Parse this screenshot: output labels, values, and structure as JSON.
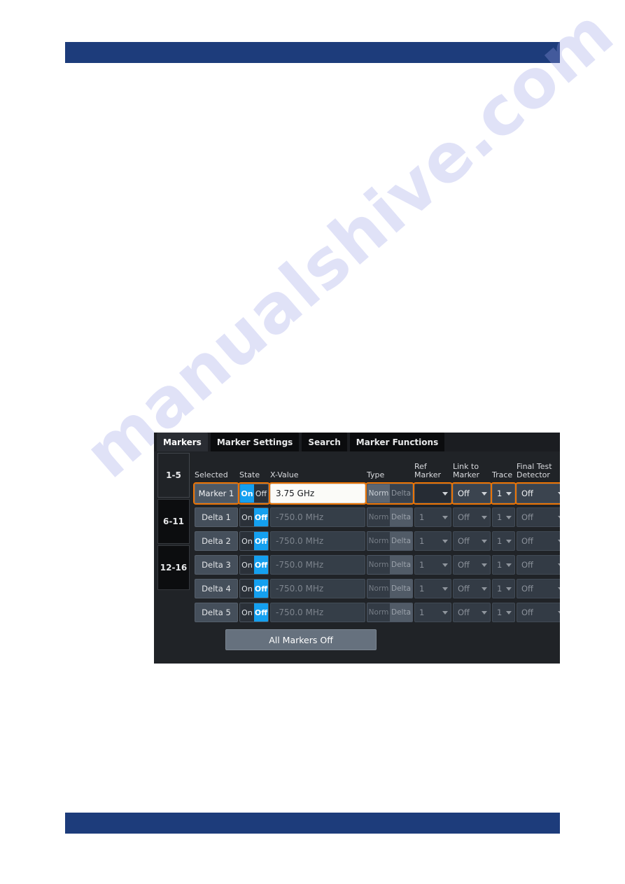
{
  "watermark": {
    "text": "manualshive.com"
  },
  "dialog": {
    "tabs": [
      {
        "label": "Markers",
        "active": true
      },
      {
        "label": "Marker Settings",
        "active": false
      },
      {
        "label": "Search",
        "active": false
      },
      {
        "label": "Marker Functions",
        "active": false
      }
    ],
    "range_buttons": [
      {
        "label": "1-5",
        "active": true
      },
      {
        "label": "6-11",
        "active": false
      },
      {
        "label": "12-16",
        "active": false
      }
    ],
    "columns": {
      "selected": "Selected",
      "state": "State",
      "xvalue": "X-Value",
      "type": "Type",
      "ref_marker_l1": "Ref",
      "ref_marker_l2": "Marker",
      "link_l1": "Link to",
      "link_l2": "Marker",
      "trace": "Trace",
      "detector_l1": "Final Test",
      "detector_l2": "Detector"
    },
    "type_options": {
      "norm": "Norm",
      "delta": "Delta"
    },
    "state_options": {
      "on": "On",
      "off": "Off"
    },
    "rows": [
      {
        "selected": "Marker 1",
        "state": "On",
        "xvalue": "3.75 GHz",
        "type": "Norm",
        "ref_marker": "",
        "link_to_marker": "Off",
        "trace": "1",
        "final_test_detector": "Off",
        "highlighted": true,
        "editing": true
      },
      {
        "selected": "Delta 1",
        "state": "Off",
        "xvalue": "-750.0 MHz",
        "type": "Delta",
        "ref_marker": "1",
        "link_to_marker": "Off",
        "trace": "1",
        "final_test_detector": "Off",
        "highlighted": false,
        "editing": false
      },
      {
        "selected": "Delta 2",
        "state": "Off",
        "xvalue": "-750.0 MHz",
        "type": "Delta",
        "ref_marker": "1",
        "link_to_marker": "Off",
        "trace": "1",
        "final_test_detector": "Off",
        "highlighted": false,
        "editing": false
      },
      {
        "selected": "Delta 3",
        "state": "Off",
        "xvalue": "-750.0 MHz",
        "type": "Delta",
        "ref_marker": "1",
        "link_to_marker": "Off",
        "trace": "1",
        "final_test_detector": "Off",
        "highlighted": false,
        "editing": false
      },
      {
        "selected": "Delta 4",
        "state": "Off",
        "xvalue": "-750.0 MHz",
        "type": "Delta",
        "ref_marker": "1",
        "link_to_marker": "Off",
        "trace": "1",
        "final_test_detector": "Off",
        "highlighted": false,
        "editing": false
      },
      {
        "selected": "Delta 5",
        "state": "Off",
        "xvalue": "-750.0 MHz",
        "type": "Delta",
        "ref_marker": "1",
        "link_to_marker": "Off",
        "trace": "1",
        "final_test_detector": "Off",
        "highlighted": false,
        "editing": false
      }
    ],
    "all_markers_off": "All Markers Off"
  },
  "colors": {
    "page_rule": "#1d3c7b",
    "accent_orange": "#ec7404",
    "accent_blue": "#14a0f0",
    "dialog_bg": "#202327"
  }
}
